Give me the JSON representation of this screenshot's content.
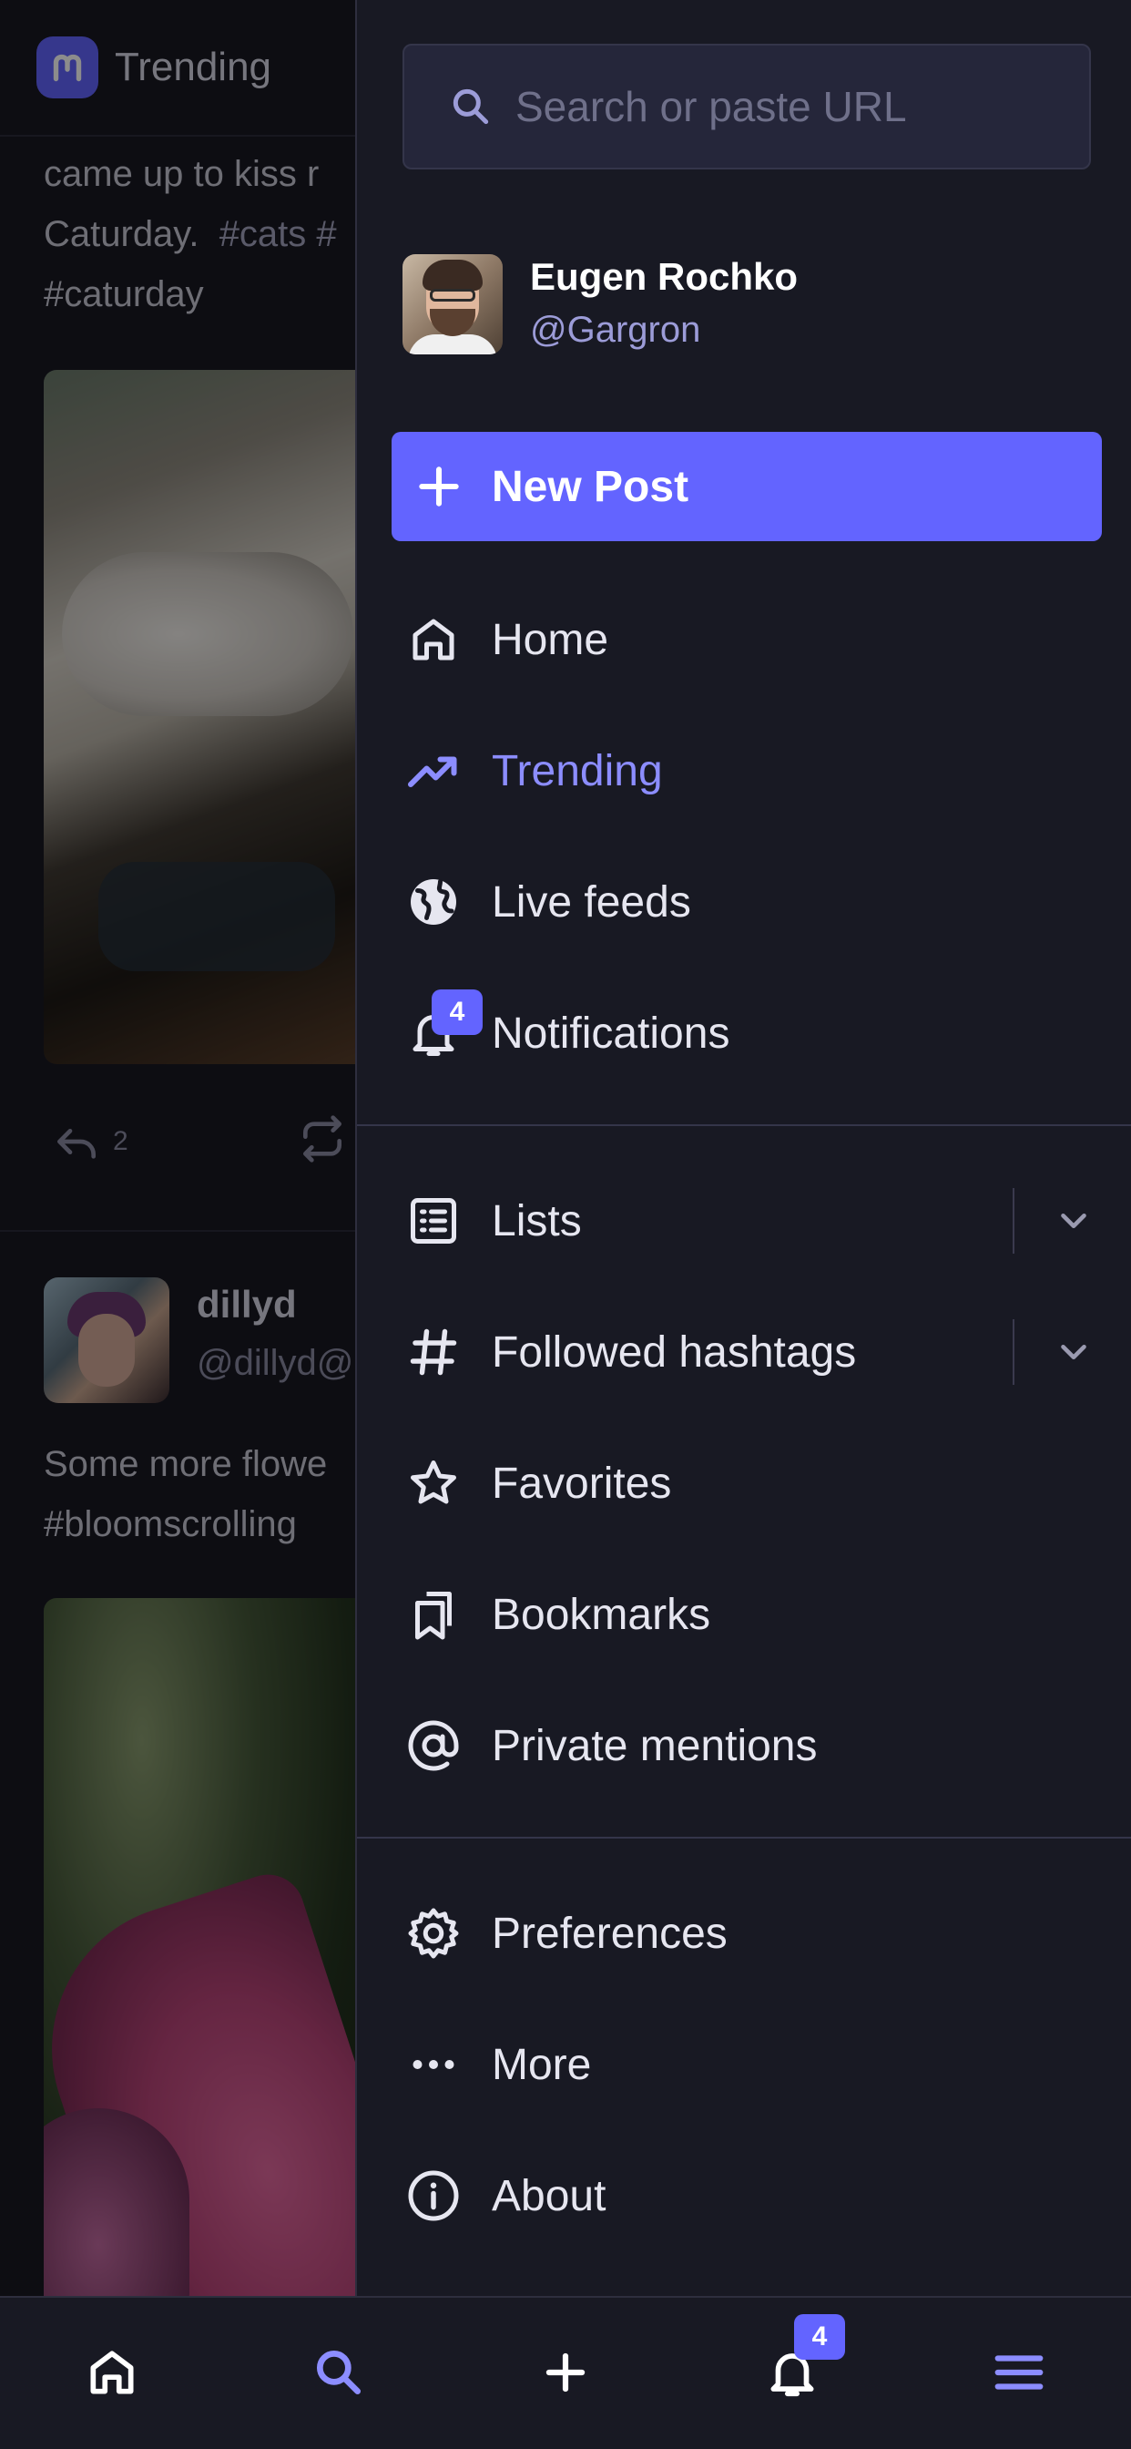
{
  "feed": {
    "header_title": "Trending",
    "post1": {
      "line1": "came up to kiss r",
      "line2_text": "Caturday.",
      "line2_tags": "#cats #",
      "line3": "#caturday",
      "reply_count": "2"
    },
    "post2": {
      "author_name": "dillyd",
      "author_handle": "@dillyd@",
      "line1": "Some more flowe",
      "line2": "#bloomscrolling"
    }
  },
  "drawer": {
    "search": {
      "placeholder": "Search or paste URL",
      "value": ""
    },
    "account": {
      "name": "Eugen Rochko",
      "handle": "@Gargron"
    },
    "new_post_label": "New Post",
    "nav": [
      {
        "label": "Home",
        "icon": "home-icon",
        "active": false
      },
      {
        "label": "Trending",
        "icon": "trending-icon",
        "active": true
      },
      {
        "label": "Live feeds",
        "icon": "globe-icon",
        "active": false
      },
      {
        "label": "Notifications",
        "icon": "bell-icon",
        "active": false,
        "badge": "4"
      },
      {
        "label": "Lists",
        "icon": "list-icon",
        "expandable": true
      },
      {
        "label": "Followed hashtags",
        "icon": "hashtag-icon",
        "expandable": true
      },
      {
        "label": "Favorites",
        "icon": "star-icon"
      },
      {
        "label": "Bookmarks",
        "icon": "bookmarks-icon"
      },
      {
        "label": "Private mentions",
        "icon": "at-icon"
      },
      {
        "label": "Preferences",
        "icon": "gear-icon"
      },
      {
        "label": "More",
        "icon": "more-icon"
      },
      {
        "label": "About",
        "icon": "info-icon"
      }
    ]
  },
  "tabbar": {
    "items": [
      {
        "icon": "home-icon"
      },
      {
        "icon": "search-icon",
        "active": true
      },
      {
        "icon": "plus-icon"
      },
      {
        "icon": "bell-icon",
        "badge": "4"
      },
      {
        "icon": "menu-icon"
      }
    ]
  },
  "colors": {
    "accent": "#6364ff",
    "accent_text": "#8c8dff",
    "drawer_bg": "#181923",
    "text": "#e6e6f0"
  }
}
